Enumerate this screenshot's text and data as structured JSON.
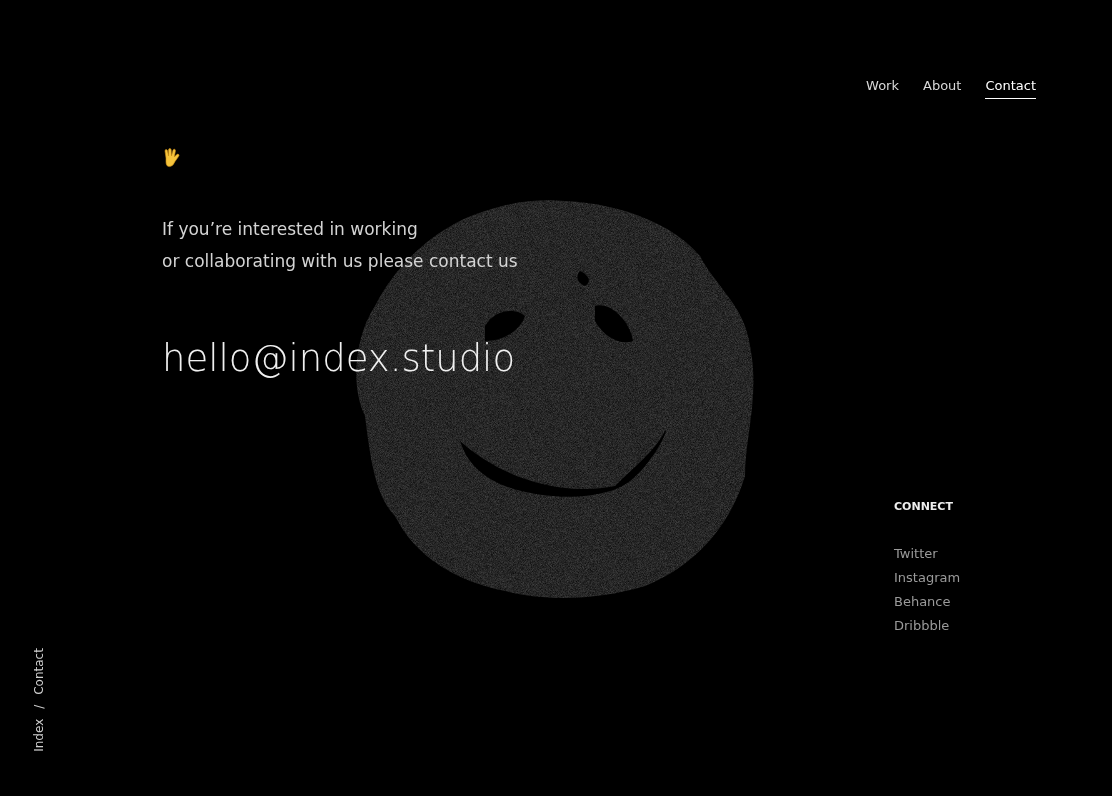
{
  "nav": [
    {
      "label": "Work",
      "selected": false
    },
    {
      "label": "About",
      "selected": false
    },
    {
      "label": "Contact",
      "selected": true
    }
  ],
  "intro": {
    "lines": [
      "If you’re interested in working",
      "or collaborating with us please contact us"
    ]
  },
  "email": "hello@index.studio",
  "connect": {
    "heading": "CONNECT",
    "links": [
      "Twitter",
      "Instagram",
      "Behance",
      "Dribbble"
    ]
  },
  "breadcrumb": {
    "items": [
      "Index",
      "Contact"
    ],
    "separator": "/"
  }
}
